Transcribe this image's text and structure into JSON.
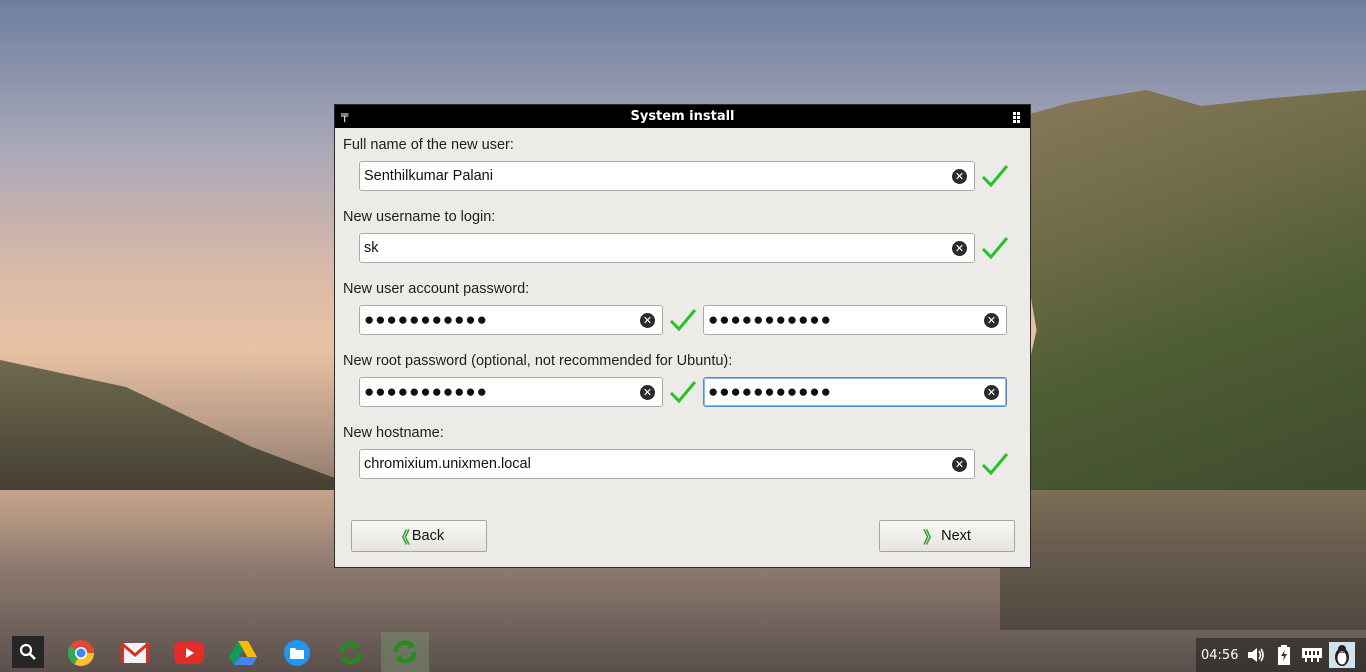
{
  "dialog": {
    "title": "System install",
    "fields": {
      "full_name_label": "Full name of the new user:",
      "full_name_value": "Senthilkumar Palani",
      "username_label": "New username to login:",
      "username_value": "sk",
      "user_password_label": "New user account password:",
      "user_password_value": "●●●●●●●●●●●",
      "user_password_confirm_value": "●●●●●●●●●●●",
      "root_password_label": "New root password (optional, not recommended for Ubuntu):",
      "root_password_value": "●●●●●●●●●●●",
      "root_password_confirm_value": "●●●●●●●●●●●",
      "hostname_label": "New hostname:",
      "hostname_value": "chromixium.unixmen.local"
    },
    "buttons": {
      "back": "Back",
      "next": "Next"
    }
  },
  "taskbar": {
    "clock": "04:56",
    "apps": [
      "search-icon",
      "chrome-icon",
      "gmail-icon",
      "youtube-icon",
      "drive-icon",
      "files-icon",
      "sync-icon",
      "sync-icon"
    ]
  },
  "colors": {
    "accent_green": "#22c322",
    "titlebar": "#000000",
    "dialog_bg": "#edebe7"
  }
}
